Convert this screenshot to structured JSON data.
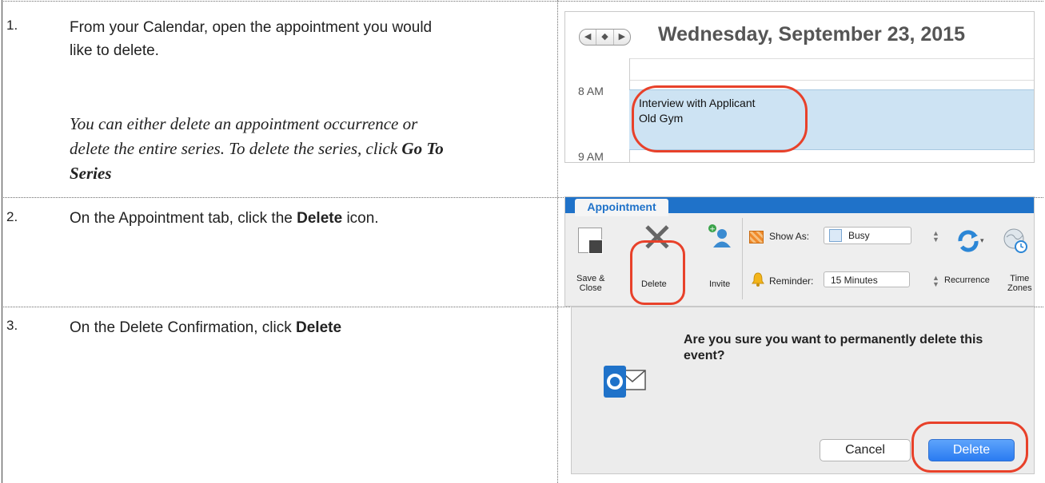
{
  "steps": [
    {
      "num": "1.",
      "text_a": "From your Calendar, open the appointment you would",
      "text_b": "like to delete.",
      "note_a": "You can either delete an appointment occurrence or",
      "note_b": "delete the entire series. To delete the series, click",
      "note_bold_a": "Go To",
      "note_bold_b": "Series"
    },
    {
      "num": "2.",
      "text_pre": "On the Appointment tab, click the",
      "text_bold": "Delete",
      "text_post": "icon."
    },
    {
      "num": "3.",
      "text_pre": "On the Delete Confirmation, click",
      "text_bold": "Delete"
    }
  ],
  "calendar": {
    "title": "Wednesday, September 23, 2015",
    "nav": [
      "◀",
      "◆",
      "▶"
    ],
    "time_8": "8 AM",
    "time_9": "9 AM",
    "event_title": "Interview with Applicant",
    "event_location": "Old Gym"
  },
  "ribbon": {
    "tab": "Appointment",
    "save_close_a": "Save &",
    "save_close_b": "Close",
    "delete": "Delete",
    "invite": "Invite",
    "show_as_label": "Show As:",
    "show_as_value": "Busy",
    "reminder_label": "Reminder:",
    "reminder_value": "15 Minutes",
    "recurrence": "Recurrence",
    "time_zones_a": "Time",
    "time_zones_b": "Zones"
  },
  "dialog": {
    "message": "Are you sure you want to permanently delete this event?",
    "cancel": "Cancel",
    "delete": "Delete"
  },
  "colors": {
    "accent": "#1f72c9",
    "highlight_circle": "#e8412a",
    "event_fill": "#cde3f3",
    "primary_button": "#2a7bf1"
  }
}
